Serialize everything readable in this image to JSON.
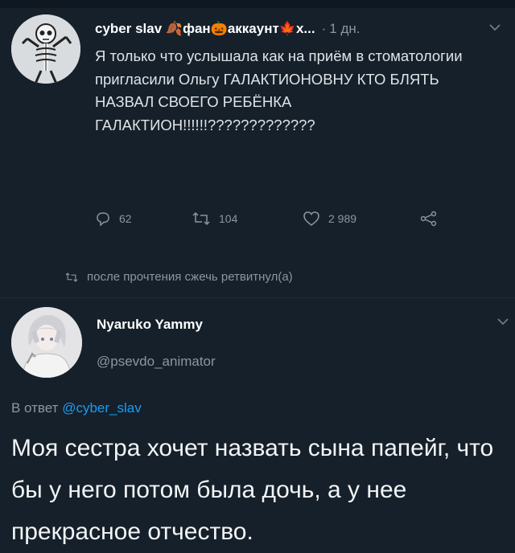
{
  "tweet": {
    "author_name": "cyber slav 🍂фан🎃аккаунт🍁х...",
    "separator": "·",
    "time": "1 дн.",
    "text": "Я только что услышала как на приём в стоматологии пригласили Ольгу ГАЛАКТИОНОВНУ КТО БЛЯТЬ НАЗВАЛ СВОЕГО РЕБЁНКА ГАЛАКТИОН!!!!!!?????????????",
    "stats": {
      "replies": "62",
      "retweets": "104",
      "likes": "2 989"
    }
  },
  "retweeted_by": "после прочтения сжечь ретвитнул(а)",
  "reply": {
    "author_name": "Nyaruko Yammy",
    "author_handle": "@psevdo_animator",
    "replying_prefix": "В ответ",
    "replying_to": "@cyber_slav",
    "text": "Моя сестра хочет назвать сына папейг, что бы у него потом была дочь, а у нее прекрасное отчество."
  },
  "colors": {
    "background": "#15202b",
    "secondary_text": "#8a96a3",
    "link": "#1d9bf0"
  },
  "icons": [
    "skeleton-avatar",
    "chevron-down-icon",
    "reply-icon",
    "retweet-icon",
    "heart-icon",
    "share-icon",
    "anime-avatar"
  ]
}
